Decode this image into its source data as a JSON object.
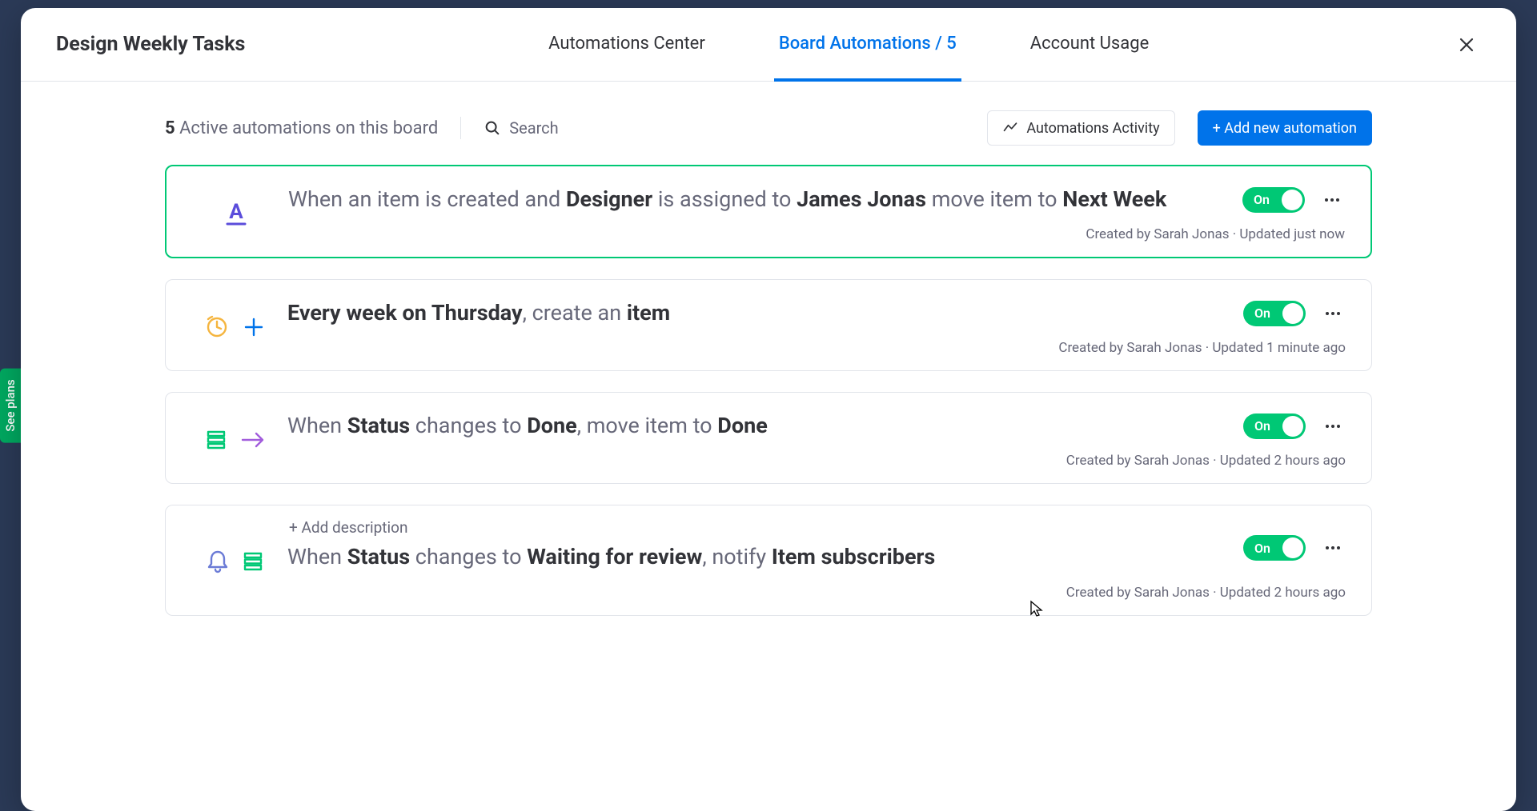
{
  "header": {
    "board_title": "Design Weekly Tasks",
    "tabs": {
      "center": "Automations Center",
      "board": "Board Automations / 5",
      "usage": "Account Usage"
    }
  },
  "toolbar": {
    "count": "5",
    "count_suffix": " Active automations on this board",
    "search_label": "Search",
    "activity_label": "Automations Activity",
    "add_label": "+ Add new automation"
  },
  "automations": [
    {
      "icon_set": "text-A",
      "segments": [
        {
          "t": "When an item is created and ",
          "b": false
        },
        {
          "t": "Designer",
          "b": true
        },
        {
          "t": " is assigned to ",
          "b": false
        },
        {
          "t": "James Jonas",
          "b": true
        },
        {
          "t": " move item to ",
          "b": false
        },
        {
          "t": "Next Week",
          "b": true
        }
      ],
      "toggle": "On",
      "meta_created": "Created by Sarah Jonas",
      "meta_updated": "Updated just now",
      "highlight": true
    },
    {
      "icon_set": "clock-plus",
      "segments": [
        {
          "t": "Every week on Thursday",
          "b": true
        },
        {
          "t": ", create an ",
          "b": false
        },
        {
          "t": "item",
          "b": true
        }
      ],
      "toggle": "On",
      "meta_created": "Created by Sarah Jonas",
      "meta_updated": "Updated 1 minute ago",
      "highlight": false
    },
    {
      "icon_set": "stack-arrow",
      "segments": [
        {
          "t": "When ",
          "b": false
        },
        {
          "t": "Status",
          "b": true
        },
        {
          "t": " changes to ",
          "b": false
        },
        {
          "t": "Done",
          "b": true
        },
        {
          "t": ", move item to ",
          "b": false
        },
        {
          "t": "Done",
          "b": true
        }
      ],
      "toggle": "On",
      "meta_created": "Created by Sarah Jonas",
      "meta_updated": "Updated 2 hours ago",
      "highlight": false
    },
    {
      "icon_set": "bell-stack",
      "segments": [
        {
          "t": "When ",
          "b": false
        },
        {
          "t": "Status",
          "b": true
        },
        {
          "t": " changes to ",
          "b": false
        },
        {
          "t": "Waiting for review",
          "b": true
        },
        {
          "t": ", notify ",
          "b": false
        },
        {
          "t": "Item subscribers",
          "b": true
        }
      ],
      "toggle": "On",
      "meta_created": "Created by Sarah Jonas",
      "meta_updated": "Updated 2 hours ago",
      "highlight": false,
      "show_add_desc": true,
      "add_desc_label": "+ Add description"
    }
  ],
  "side": {
    "see_plans": "See plans"
  }
}
